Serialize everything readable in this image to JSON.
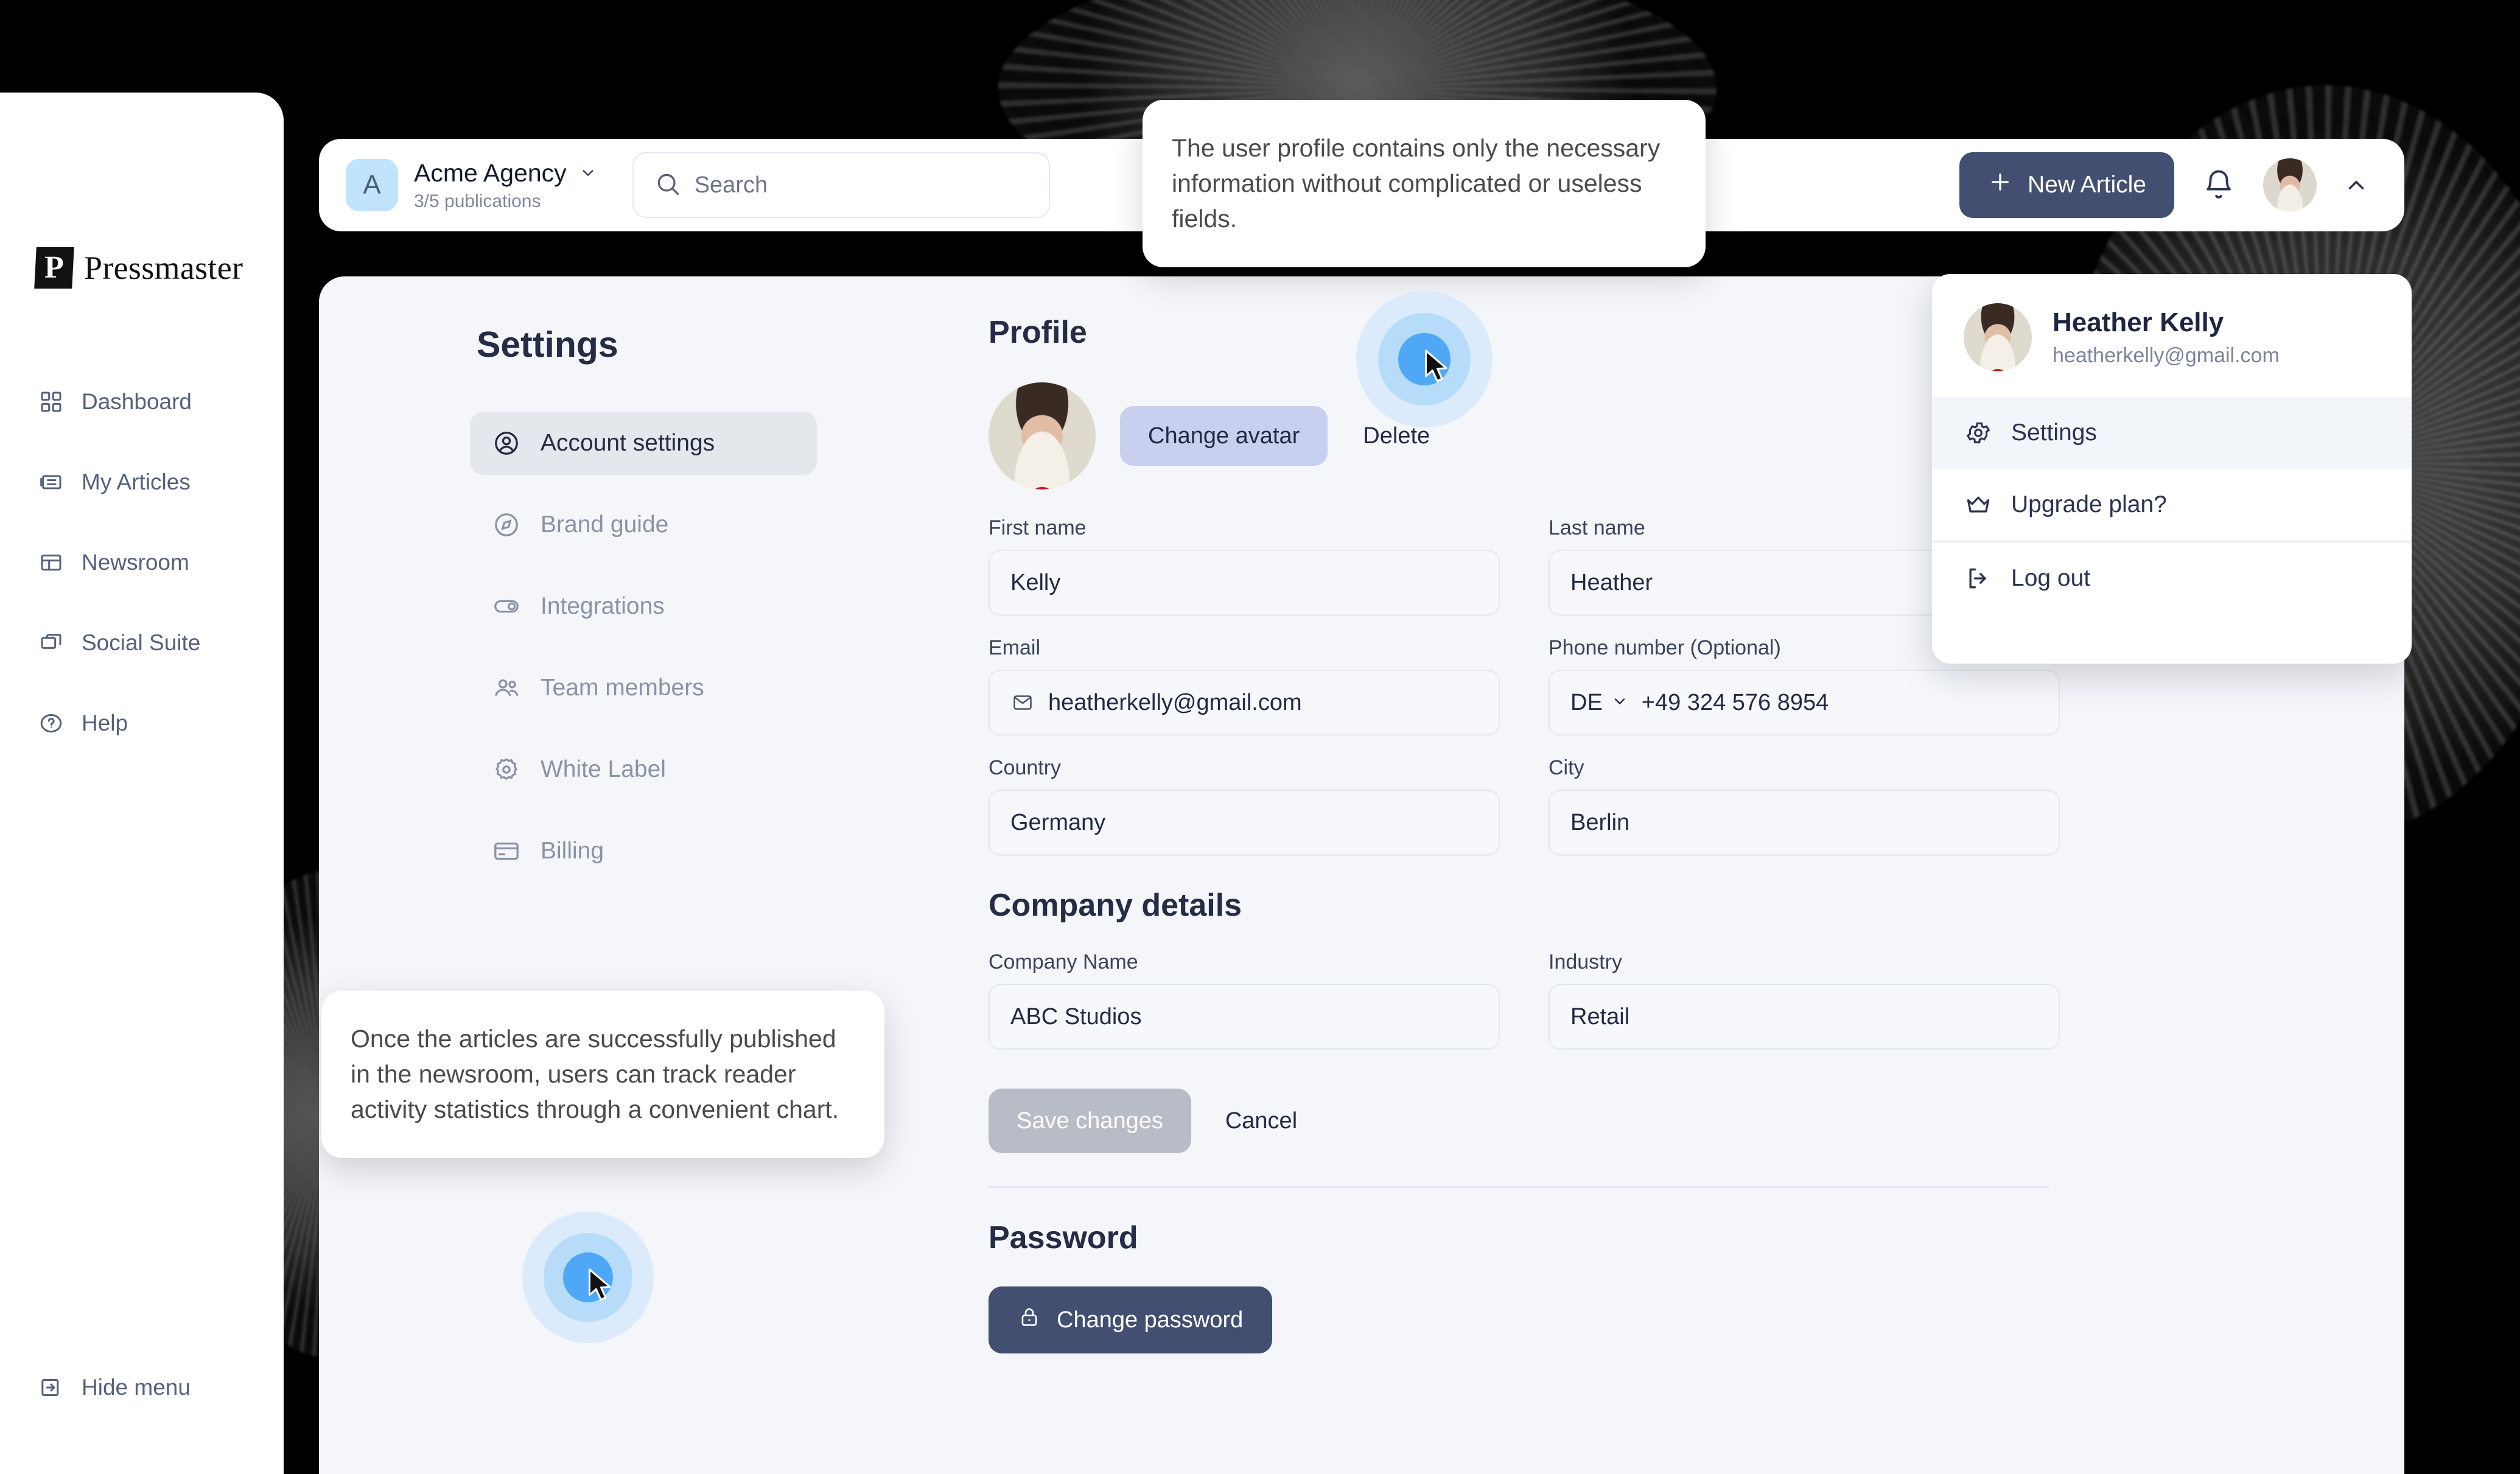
{
  "brand": {
    "logo_letter": "P",
    "logo_text": "Pressmaster"
  },
  "sidebar": {
    "items": [
      {
        "label": "Dashboard",
        "icon": "grid-icon"
      },
      {
        "label": "My Articles",
        "icon": "newspaper-icon"
      },
      {
        "label": "Newsroom",
        "icon": "layout-icon"
      },
      {
        "label": "Social Suite",
        "icon": "windows-icon"
      },
      {
        "label": "Help",
        "icon": "question-circle-icon"
      }
    ],
    "hide_menu_label": "Hide menu",
    "hide_menu_icon": "arrow-right-box-icon"
  },
  "topbar": {
    "org_initial": "A",
    "org_name": "Acme Agency",
    "org_sub": "3/5 publications",
    "org_chevron_icon": "chevron-down-icon",
    "search_placeholder": "Search",
    "search_value": "",
    "search_icon": "search-icon",
    "new_article_label": "New Article",
    "new_article_icon": "plus-icon",
    "bell_icon": "bell-icon",
    "avatar_icon": "user-avatar",
    "caret_icon": "chevron-up-icon"
  },
  "settings": {
    "title": "Settings",
    "nav": [
      {
        "label": "Account settings",
        "icon": "user-circle-icon",
        "active": true
      },
      {
        "label": "Brand guide",
        "icon": "compass-icon",
        "active": false
      },
      {
        "label": "Integrations",
        "icon": "toggle-icon",
        "active": false
      },
      {
        "label": "Team members",
        "icon": "users-icon",
        "active": false
      },
      {
        "label": "White Label",
        "icon": "gear-badge-icon",
        "active": false
      },
      {
        "label": "Billing",
        "icon": "credit-card-icon",
        "active": false
      }
    ]
  },
  "profile": {
    "section_title": "Profile",
    "change_avatar_label": "Change avatar",
    "delete_label": "Delete",
    "fields": {
      "first_name_label": "First name",
      "first_name_value": "Kelly",
      "last_name_label": "Last name",
      "last_name_value": "Heather",
      "email_label": "Email",
      "email_value": "heatherkelly@gmail.com",
      "email_icon": "mail-icon",
      "phone_label": "Phone number (Optional)",
      "phone_country": "DE",
      "phone_country_icon": "chevron-down-icon",
      "phone_value": "+49 324 576 8954",
      "country_label": "Country",
      "country_value": "Germany",
      "city_label": "City",
      "city_value": "Berlin"
    }
  },
  "company": {
    "section_title": "Company details",
    "company_name_label": "Company Name",
    "company_name_value": "ABC Studios",
    "industry_label": "Industry",
    "industry_value": "Retail"
  },
  "form_actions": {
    "save_label": "Save changes",
    "cancel_label": "Cancel"
  },
  "password": {
    "section_title": "Password",
    "change_password_label": "Change password",
    "lock_icon": "lock-icon"
  },
  "user_menu": {
    "name": "Heather Kelly",
    "email": "heatherkelly@gmail.com",
    "items": [
      {
        "label": "Settings",
        "icon": "gear-icon"
      },
      {
        "label": "Upgrade plan?",
        "icon": "crown-icon"
      },
      {
        "label": "Log out",
        "icon": "logout-icon"
      }
    ]
  },
  "callouts": {
    "top": "The user profile contains only the necessary information without complicated or useless fields.",
    "bottom": "Once the articles are successfully published in the newsroom, users can track reader activity statistics through a convenient chart."
  },
  "colors": {
    "page_bg": "#000000",
    "panel_bg": "#f4f6fa",
    "card_bg": "#ffffff",
    "accent_dark": "#424f71",
    "accent_lavender": "#c9cfee",
    "org_badge": "#bfe4fb",
    "muted_text": "#8a93a6",
    "save_disabled": "#b8bcc6",
    "cursor_ring": "#4fa8f5"
  }
}
